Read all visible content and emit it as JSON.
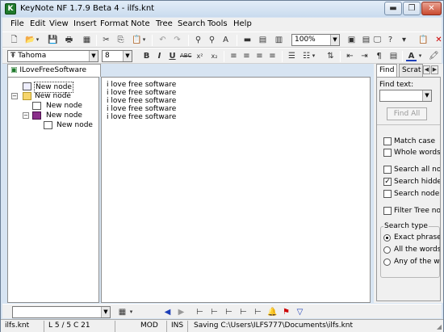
{
  "window": {
    "title": "KeyNote NF  1.7.9 Beta 4 - ilfs.knt",
    "app_icon_glyph": "K",
    "minimize_glyph": "▬",
    "restore_glyph": "❐",
    "close_glyph": "✕"
  },
  "menu": {
    "items": [
      "File",
      "Edit",
      "View",
      "Insert",
      "Format",
      "Note",
      "Tree",
      "Search",
      "Tools",
      "Help"
    ]
  },
  "toolbar": {
    "zoom_value": "100%",
    "font_name": "Tahoma",
    "font_size": "8"
  },
  "notes_tab": {
    "label": "ILoveFreeSoftware"
  },
  "tree": {
    "nodes": [
      {
        "label": "New node"
      },
      {
        "label": "New node"
      },
      {
        "label": "New node"
      },
      {
        "label": "New node"
      },
      {
        "label": "New node"
      }
    ]
  },
  "editor": {
    "lines": [
      "i love free software",
      "i love free software",
      "i love free software",
      "i love free software",
      "i love free software"
    ]
  },
  "find_panel": {
    "tab_find": "Find",
    "tab_scratch": "Scrat",
    "find_text_label": "Find text:",
    "find_all_button": "Find All",
    "options": [
      {
        "label": "Match case",
        "checked": false
      },
      {
        "label": "Whole words or",
        "checked": false
      },
      {
        "label": "Search all notes",
        "checked": false
      },
      {
        "label": "Search hidden n",
        "checked": true
      },
      {
        "label": "Search node na",
        "checked": false
      },
      {
        "label": "Filter Tree note",
        "checked": false
      }
    ],
    "search_type_label": "Search type",
    "search_types": [
      {
        "label": "Exact phrase",
        "selected": true
      },
      {
        "label": "All the words",
        "selected": false
      },
      {
        "label": "Any of the w",
        "selected": false
      }
    ]
  },
  "status": {
    "file": "ilfs.knt",
    "position": "L 5 / 5  C 21",
    "mod": "MOD",
    "ins": "INS",
    "message": "Saving C:\\Users\\ILFS777\\Documents\\ilfs.knt"
  }
}
